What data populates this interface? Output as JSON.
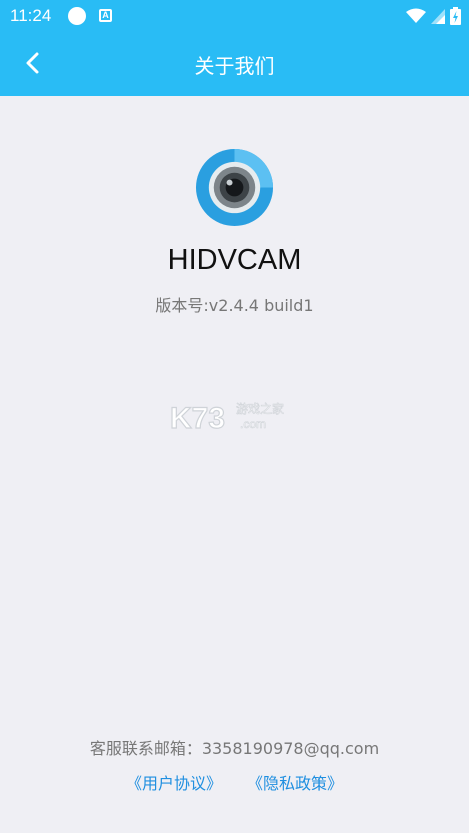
{
  "status_bar": {
    "time": "11:24",
    "a_badge": "A",
    "icons": [
      "wifi-icon",
      "signal-icon",
      "battery-charging-icon"
    ]
  },
  "header": {
    "title": "关于我们",
    "back_icon": "chevron-left-icon"
  },
  "app": {
    "name": "HIDVCAM",
    "version": "版本号:v2.4.4 build1"
  },
  "watermark": {
    "brand": "K73",
    "tagline": "游戏之家",
    "domain": ".com"
  },
  "footer": {
    "contact": "客服联系邮箱：3358190978@qq.com",
    "user_agreement": "《用户协议》",
    "privacy_policy": "《隐私政策》"
  },
  "colors": {
    "header": "#29bcf5",
    "background": "#efeff4",
    "link": "#1f8fe0"
  }
}
